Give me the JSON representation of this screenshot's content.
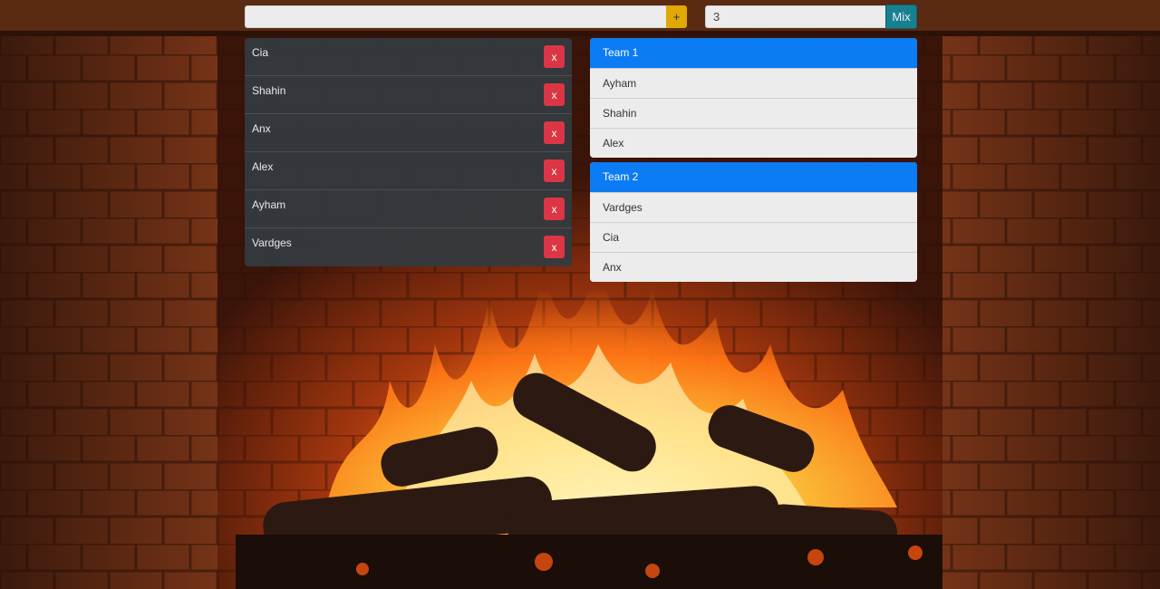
{
  "add_form": {
    "name_value": "",
    "name_placeholder": "",
    "add_label": "+"
  },
  "mix_form": {
    "team_count_value": "3",
    "mix_label": "Mix"
  },
  "players": [
    {
      "name": "Cia",
      "remove_label": "x"
    },
    {
      "name": "Shahin",
      "remove_label": "x"
    },
    {
      "name": "Anx",
      "remove_label": "x"
    },
    {
      "name": "Alex",
      "remove_label": "x"
    },
    {
      "name": "Ayham",
      "remove_label": "x"
    },
    {
      "name": "Vardges",
      "remove_label": "x"
    }
  ],
  "teams": [
    {
      "title": "Team 1",
      "members": [
        "Ayham",
        "Shahin",
        "Alex"
      ]
    },
    {
      "title": "Team 2",
      "members": [
        "Vardges",
        "Cia",
        "Anx"
      ]
    }
  ],
  "colors": {
    "add_button": "#e0a800",
    "mix_button": "#17818f",
    "remove_button": "#dc3545",
    "team_header": "#0b7cf3",
    "player_list_bg": "#343a40"
  }
}
